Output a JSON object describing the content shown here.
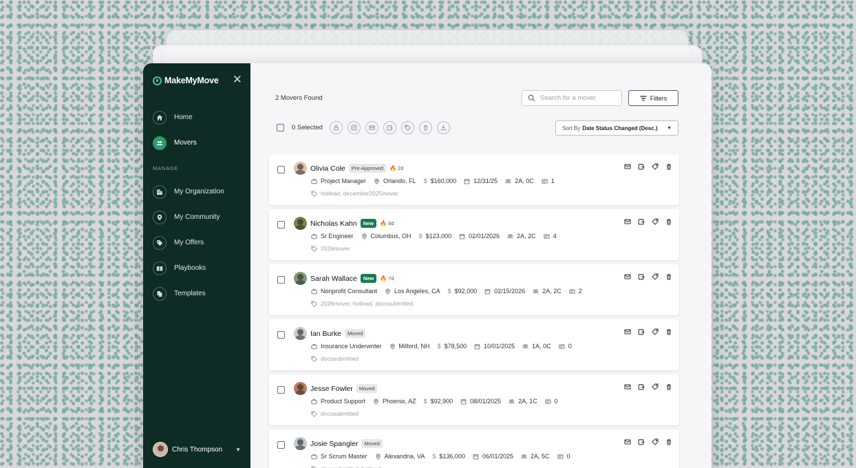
{
  "brand": {
    "name": "MakeMyMove"
  },
  "nav": {
    "main": [
      {
        "label": "Home",
        "icon": "home-icon"
      },
      {
        "label": "Movers",
        "icon": "users-icon",
        "active": true
      }
    ],
    "section_label": "MANAGE",
    "manage": [
      {
        "label": "My Organization",
        "icon": "building-icon"
      },
      {
        "label": "My Community",
        "icon": "location-pin-icon"
      },
      {
        "label": "My Offers",
        "icon": "tag-icon"
      },
      {
        "label": "Playbooks",
        "icon": "book-icon"
      },
      {
        "label": "Templates",
        "icon": "copy-icon"
      }
    ]
  },
  "user": {
    "name": "Chris Thompson"
  },
  "header": {
    "found": "2 Movers Found",
    "search_placeholder": "Search for a mover",
    "filters_label": "Filters",
    "selected": "0 Selected",
    "sort_prefix": "Sort By",
    "sort_value": "Date Status Changed (Desc.)"
  },
  "colors": {
    "sidebar": "#0f2b26",
    "accent": "#2a9d6b",
    "badge_new": "#157a4f"
  },
  "movers": [
    {
      "name": "Olivia Cole",
      "status": "Pre-Approved",
      "status_style": "gray",
      "age": "2d",
      "job": "Project Manager",
      "location": "Orlando, FL",
      "budget": "$160,000",
      "date": "12/31/25",
      "household": "2A, 0C",
      "docs": "1",
      "tags": "hotlead, december2025mover",
      "avatar_color": "#e0c2a8"
    },
    {
      "name": "Nicholas Kahn",
      "status": "New",
      "status_style": "green",
      "age": "6d",
      "job": "Sr Engineer",
      "location": "Columbus, OH",
      "budget": "$123,000",
      "date": "02/01/2026",
      "household": "2A, 2C",
      "docs": "4",
      "tags": "2026mover",
      "avatar_color": "#6f8a4e"
    },
    {
      "name": "Sarah Wallace",
      "status": "New",
      "status_style": "green",
      "age": "7d",
      "job": "Nonprofit Consultant",
      "location": "Los Angeles, CA",
      "budget": "$92,000",
      "date": "02/15/2026",
      "household": "2A, 2C",
      "docs": "2",
      "tags": "2026mover, hotlead, docssubmitted",
      "avatar_color": "#7a9a78"
    },
    {
      "name": "Ian Burke",
      "status": "Moved",
      "status_style": "gray",
      "age": "",
      "job": "Insurance Underwriter",
      "location": "Milford, NH",
      "budget": "$78,500",
      "date": "10/01/2025",
      "household": "1A, 0C",
      "docs": "0",
      "tags": "docssubmitted",
      "avatar_color": "#c9ccd1"
    },
    {
      "name": "Jesse Fowler",
      "status": "Moved",
      "status_style": "gray",
      "age": "",
      "job": "Product Support",
      "location": "Phoenix, AZ",
      "budget": "$92,900",
      "date": "08/01/2025",
      "household": "2A, 1C",
      "docs": "0",
      "tags": "docssubmitted",
      "avatar_color": "#b67b62"
    },
    {
      "name": "Josie Spangler",
      "status": "Moved",
      "status_style": "gray",
      "age": "",
      "job": "Sr Scrum Master",
      "location": "Alexandria, VA",
      "budget": "$136,000",
      "date": "06/01/2025",
      "household": "2A, 5C",
      "docs": "0",
      "tags": "docssubmitted, hotlead",
      "avatar_color": "#b8cbd3"
    }
  ]
}
